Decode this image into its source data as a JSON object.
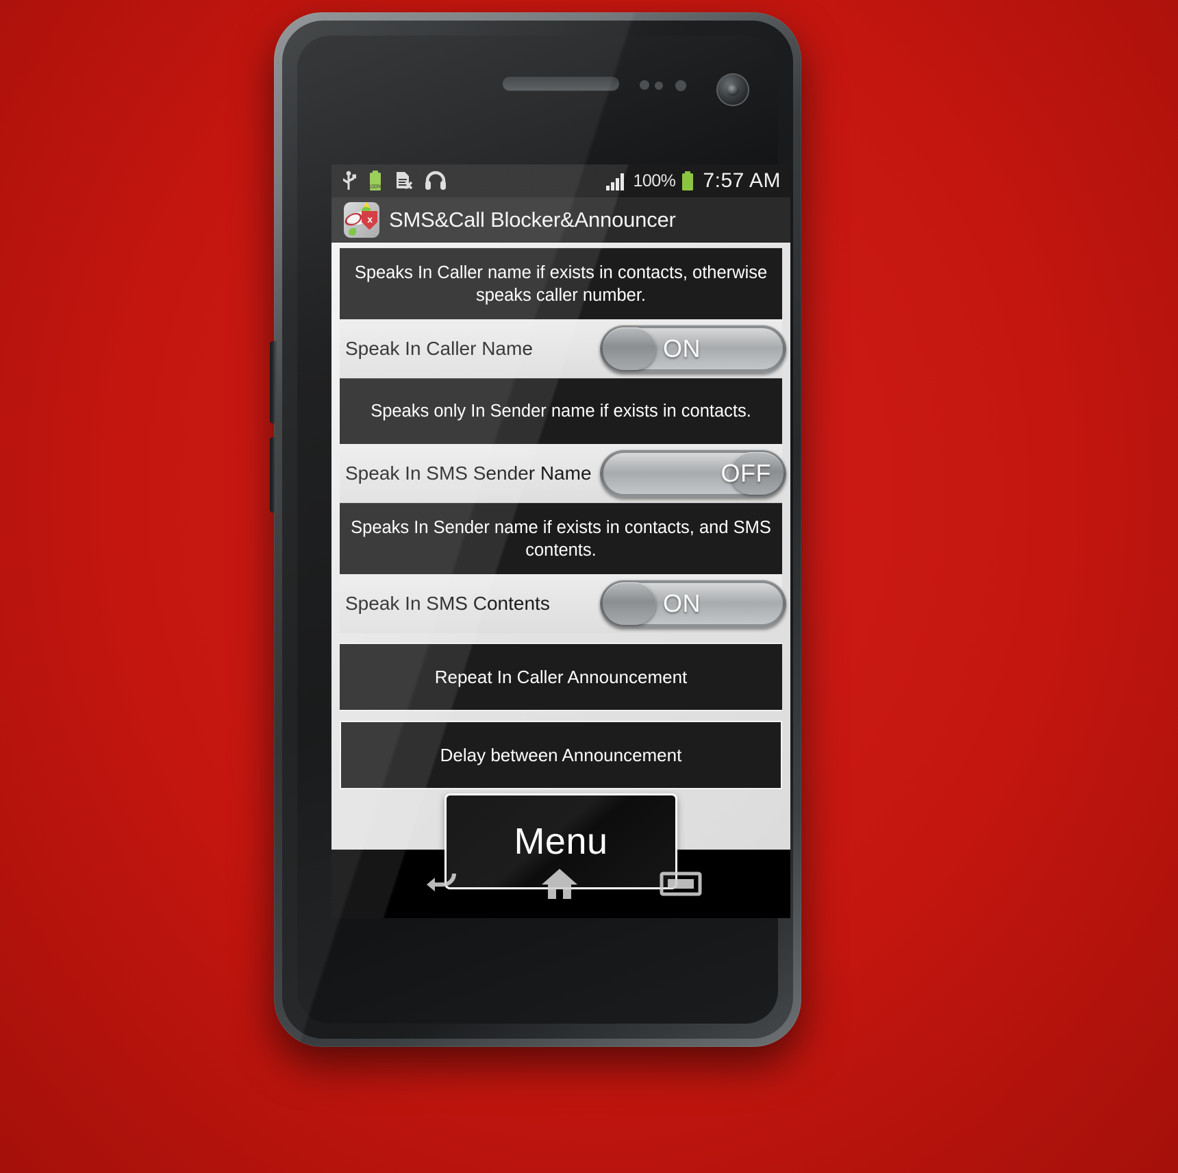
{
  "status_bar": {
    "left_icons": [
      "usb-icon",
      "battery-charging-icon",
      "sim-card-error-icon",
      "headphones-icon"
    ],
    "battery_small_label": "100%",
    "signal_icon": "signal-bars-icon",
    "battery_percent": "100%",
    "battery_icon": "battery-full-icon",
    "time": "7:57 AM"
  },
  "title_bar": {
    "icon": "app-icon",
    "title": "SMS&Call Blocker&Announcer"
  },
  "settings": [
    {
      "description": "Speaks In Caller name if exists in contacts, otherwise speaks caller number.",
      "label": "Speak In Caller Name",
      "state": "ON"
    },
    {
      "description": "Speaks only In Sender name if exists in contacts.",
      "label": "Speak In SMS Sender Name",
      "state": "OFF"
    },
    {
      "description": "Speaks In Sender name if exists in contacts, and SMS contents.",
      "label": "Speak In SMS Contents",
      "state": "ON"
    }
  ],
  "actions": [
    {
      "label": "Repeat In Caller Announcement"
    },
    {
      "label": "Delay between Announcement"
    }
  ],
  "menu_button": {
    "label": "Menu"
  },
  "nav_bar": {
    "back": "back-icon",
    "home": "home-icon",
    "recents": "recent-apps-icon"
  },
  "colors": {
    "background": "#c4160f",
    "panel_dark": "#1c1c1c",
    "panel_light": "#e4e4e4",
    "title_bar": "#2a2a2a",
    "status_bar": "#1b1b1b",
    "battery_green": "#8cc63f"
  }
}
